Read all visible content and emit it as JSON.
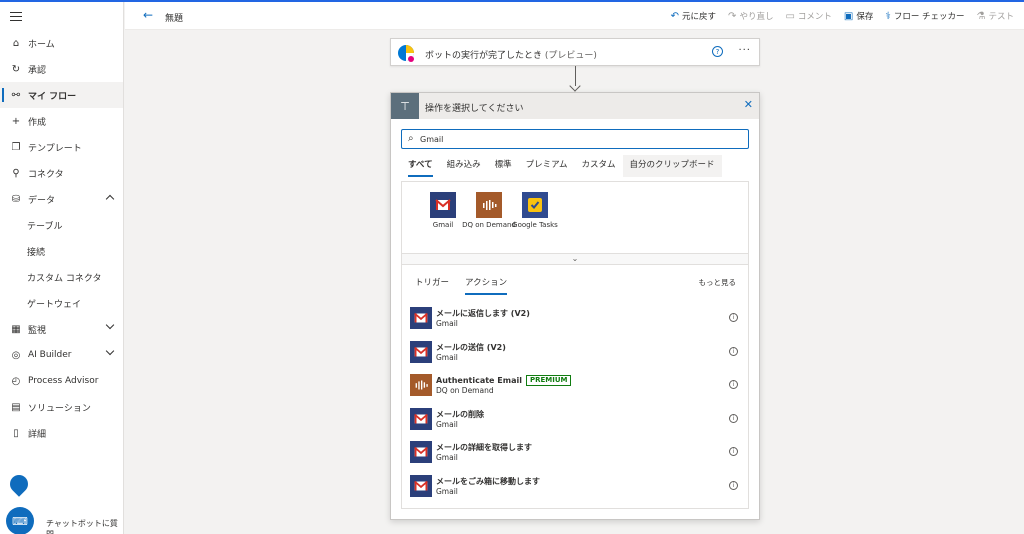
{
  "header": {
    "back_label": "←",
    "title": "無題",
    "toolbar": [
      {
        "label": "元に戻す",
        "icon": "undo-icon",
        "glyph": "↶",
        "enabled": true
      },
      {
        "label": "やり直し",
        "icon": "redo-icon",
        "glyph": "↷",
        "enabled": false
      },
      {
        "label": "コメント",
        "icon": "comment-icon",
        "glyph": "▭",
        "enabled": false
      },
      {
        "label": "保存",
        "icon": "save-icon",
        "glyph": "▣",
        "enabled": true
      },
      {
        "label": "フロー チェッカー",
        "icon": "stethoscope-icon",
        "glyph": "⚕",
        "enabled": true
      },
      {
        "label": "テスト",
        "icon": "flask-icon",
        "glyph": "⚗",
        "enabled": false
      }
    ]
  },
  "sidebar": {
    "items": [
      {
        "name": "home",
        "label": "ホーム",
        "glyph": "⌂"
      },
      {
        "name": "approvals",
        "label": "承認",
        "glyph": "↻"
      },
      {
        "name": "my-flows",
        "label": "マイ フロー",
        "glyph": "⚯",
        "active": true
      },
      {
        "name": "create",
        "label": "作成",
        "glyph": "+"
      },
      {
        "name": "templates",
        "label": "テンプレート",
        "glyph": "❐"
      },
      {
        "name": "connectors",
        "label": "コネクタ",
        "glyph": "⚲"
      },
      {
        "name": "data",
        "label": "データ",
        "glyph": "⛁",
        "expanded": true
      },
      {
        "name": "tables",
        "label": "テーブル",
        "sub": true
      },
      {
        "name": "connections",
        "label": "接続",
        "sub": true
      },
      {
        "name": "custom-connectors",
        "label": "カスタム コネクタ",
        "sub": true
      },
      {
        "name": "gateways",
        "label": "ゲートウェイ",
        "sub": true
      },
      {
        "name": "monitor",
        "label": "監視",
        "glyph": "▦",
        "collapsed": true
      },
      {
        "name": "ai-builder",
        "label": "AI Builder",
        "glyph": "◎",
        "collapsed": true
      },
      {
        "name": "process-advisor",
        "label": "Process Advisor",
        "glyph": "◴"
      },
      {
        "name": "solutions",
        "label": "ソリューション",
        "glyph": "▤"
      },
      {
        "name": "learn",
        "label": "詳細",
        "glyph": "▯"
      }
    ],
    "chatbot_label": "チャットボットに質問"
  },
  "trigger": {
    "label": "ボットの実行が完了したとき",
    "preview": "(プレビュー)",
    "help_glyph": "?",
    "more_glyph": "···"
  },
  "picker": {
    "title": "操作を選択してください",
    "close_glyph": "✕",
    "search": {
      "value": "Gmail",
      "placeholder": ""
    },
    "categories": [
      {
        "label": "すべて",
        "active": true
      },
      {
        "label": "組み込み"
      },
      {
        "label": "標準"
      },
      {
        "label": "プレミアム"
      },
      {
        "label": "カスタム"
      },
      {
        "label": "自分のクリップボード",
        "highlight": true
      }
    ],
    "connectors": [
      {
        "name": "gmail",
        "label": "Gmail"
      },
      {
        "name": "dq-on-demand",
        "label": "DQ on Demand"
      },
      {
        "name": "google-tasks",
        "label": "Google Tasks"
      }
    ],
    "action_tabs": [
      {
        "label": "トリガー"
      },
      {
        "label": "アクション",
        "active": true
      }
    ],
    "see_more": "もっと見る",
    "actions": [
      {
        "name": "メールに返信します (V2)",
        "connector": "Gmail",
        "tile": "gmail"
      },
      {
        "name": "メールの送信 (V2)",
        "connector": "Gmail",
        "tile": "gmail"
      },
      {
        "name": "Authenticate Email",
        "connector": "DQ on Demand",
        "tile": "dq",
        "badge": "PREMIUM"
      },
      {
        "name": "メールの削除",
        "connector": "Gmail",
        "tile": "gmail"
      },
      {
        "name": "メールの詳細を取得します",
        "connector": "Gmail",
        "tile": "gmail"
      },
      {
        "name": "メールをごみ箱に移動します",
        "connector": "Gmail",
        "tile": "gmail"
      }
    ]
  },
  "colors": {
    "accent": "#0f6cbd",
    "premium": "#107c10",
    "gmail_tile": "#2b3f7a",
    "dq_tile": "#a45a2a"
  }
}
